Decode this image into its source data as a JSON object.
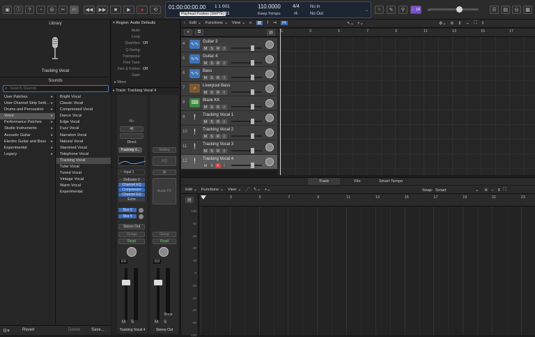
{
  "control_bar": {
    "position_time": "01:00:00:00.00",
    "bars": [
      "1",
      "1",
      "1",
      "1"
    ],
    "bars_row1": "1  1  001",
    "bars_row2": "1  1  001",
    "tooltip": "Playhead Position (SMPTE)",
    "tempo": "110.0000",
    "tempo_mode": "Keep Tempo",
    "time_sig": "4/4",
    "time_sig_div": "/4",
    "in_label": "No In",
    "out_label": "No Out",
    "count_in": "♩14",
    "icons": [
      "library-icon",
      "info-icon",
      "help-icon",
      "smart-controls-icon",
      "mixer-icon",
      "editors-icon",
      "scissors-icon"
    ]
  },
  "library": {
    "title": "Library",
    "preset_name": "Tracking Vocal",
    "sounds_header": "Sounds",
    "search_placeholder": "Search Sounds",
    "categories": [
      "User Patches",
      "User Channel Strip Setti...",
      "Drums and Percussion",
      "Voice",
      "Performance Patches",
      "Studio Instruments",
      "Acoustic Guitar",
      "Electric Guitar and Bass",
      "Experimental",
      "Legacy"
    ],
    "patches": [
      "Bright Vocal",
      "Classic Vocal",
      "Compressed Vocal",
      "Dance Vocal",
      "Edge Vocal",
      "Fuzz Vocal",
      "Narration Vocal",
      "Natural Vocal",
      "Slammed Vocal",
      "Telephone Vocal",
      "Tracking Vocal",
      "Tube Vocal",
      "Tuned Vocal",
      "Vintage Vocal",
      "Warm Vocal",
      "Experimental"
    ],
    "revert": "Revert",
    "delete": "Delete",
    "save": "Save..."
  },
  "inspector": {
    "region_header": "Region: Audio Defaults",
    "rows": [
      {
        "k": "Mute:",
        "v": ""
      },
      {
        "k": "Loop:",
        "v": ""
      },
      {
        "k": "Quantize:",
        "v": "Off"
      },
      {
        "k": "Q-Swing:",
        "v": ""
      },
      {
        "k": "Transpose:",
        "v": ""
      },
      {
        "k": "Fine Tune:",
        "v": ""
      },
      {
        "k": "Flex & Follow:",
        "v": "Off"
      },
      {
        "k": "Gain:",
        "v": ""
      }
    ],
    "more": "More",
    "track_header": "Track:  Tracking Vocal 4",
    "strip1": {
      "mic": "Mic",
      "fmt": "48",
      "input": "Input 1",
      "direct": "Direct",
      "setting": "Tracking V...",
      "eq": "",
      "plugins": [
        "DeEsser 2",
        "Channel EQ",
        "Compressor",
        "Channel EQ",
        "Echo"
      ],
      "sends": [
        "Bus 3",
        "Bus 4"
      ],
      "output": "Stereo Out",
      "group": "Group",
      "automation": "Read",
      "pan_value": "0.0",
      "volume_value": "0.0",
      "name": "Tracking Vocal 4",
      "m": "M",
      "s": "S"
    },
    "strip2": {
      "setting": "Setting",
      "eq": "EQ",
      "audio_fx": "Audio FX",
      "group": "Group",
      "automation": "Read",
      "volume_value": "0.0",
      "bnce": "Bnce",
      "name": "Stereo Out",
      "m": "M",
      "s": "S"
    }
  },
  "tracks_toolbar": {
    "edit": "Edit",
    "functions": "Functions",
    "view": "View"
  },
  "ruler": [
    "1",
    "3",
    "5",
    "7",
    "9",
    "11",
    "13",
    "15",
    "17"
  ],
  "tracks": [
    {
      "num": "4",
      "name": "Guitar 3",
      "icon": "audio-waveform-icon",
      "color": "#3f74b8"
    },
    {
      "num": "5",
      "name": "Guitar 4",
      "icon": "audio-waveform-icon",
      "color": "#3f74b8"
    },
    {
      "num": "6",
      "name": "Bass",
      "icon": "audio-waveform-icon",
      "color": "#3f74b8"
    },
    {
      "num": "7",
      "name": "Liverpool Bass",
      "icon": "bass-guitar-icon",
      "color": "#7a5a30"
    },
    {
      "num": "8",
      "name": "Blank KK",
      "icon": "keyboard-icon",
      "color": "#3c8a3c"
    },
    {
      "num": "9",
      "name": "Tracking Vocal 1",
      "icon": "microphone-icon",
      "color": "#555555"
    },
    {
      "num": "10",
      "name": "Tracking Vocal 2",
      "icon": "microphone-icon",
      "color": "#555555"
    },
    {
      "num": "11",
      "name": "Tracking Vocal 3",
      "icon": "microphone-icon",
      "color": "#555555"
    },
    {
      "num": "12",
      "name": "Tracking Vocal 4",
      "icon": "microphone-icon",
      "color": "#555555"
    }
  ],
  "track_buttons": [
    "M",
    "S",
    "R",
    "I"
  ],
  "editor": {
    "tabs": [
      "Track",
      "File",
      "Smart Tempo"
    ],
    "edit": "Edit",
    "functions": "Functions",
    "view": "View",
    "snap_label": "Snap:",
    "snap_value": "Smart",
    "ruler": [
      "1",
      "3",
      "5",
      "7",
      "9",
      "11",
      "13",
      "15",
      "17",
      "19",
      "21",
      "23"
    ],
    "db_scale": [
      "100",
      "80",
      "60",
      "40",
      "20",
      "0",
      "-20",
      "-40",
      "-60",
      "-80",
      "-100"
    ]
  },
  "colors": {
    "accent_blue": "#3a6ab8",
    "record_red": "#d53a3a",
    "selected_track": "#5a5a5a",
    "count_in_purple": "#7a4fd1"
  }
}
